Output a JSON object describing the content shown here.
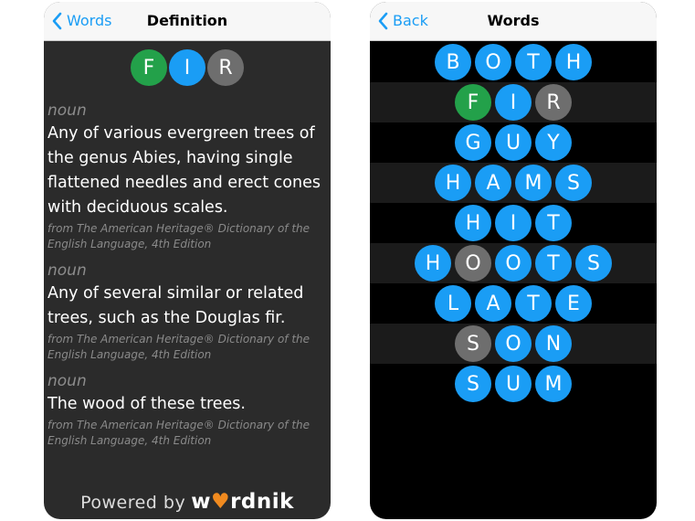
{
  "definition_screen": {
    "nav": {
      "back_label": "Words",
      "title": "Definition"
    },
    "word_tiles": [
      {
        "letter": "F",
        "color": "#23a14a"
      },
      {
        "letter": "I",
        "color": "#1a9df5"
      },
      {
        "letter": "R",
        "color": "#6e6e6e"
      }
    ],
    "definitions": [
      {
        "pos": "noun",
        "text": "Any of various evergreen trees of the genus Abies, having single flattened needles and erect cones with deciduous scales.",
        "source": "from The American Heritage® Dictionary of the English Language, 4th Edition"
      },
      {
        "pos": "noun",
        "text": "Any of several similar or related trees, such as the Douglas fir.",
        "source": "from The American Heritage® Dictionary of the English Language, 4th Edition"
      },
      {
        "pos": "noun",
        "text": "The wood of these trees.",
        "source": "from The American Heritage® Dictionary of the English Language, 4th Edition"
      }
    ],
    "powered_by": {
      "prefix": "Powered by",
      "brand_start": "w",
      "brand_heart": "♥",
      "brand_end": "rdnik"
    }
  },
  "words_screen": {
    "nav": {
      "back_label": "Back",
      "title": "Words"
    },
    "words": [
      {
        "word": "BOTH",
        "tiles": [
          {
            "letter": "B",
            "color": "blue"
          },
          {
            "letter": "O",
            "color": "blue"
          },
          {
            "letter": "T",
            "color": "blue"
          },
          {
            "letter": "H",
            "color": "blue"
          }
        ]
      },
      {
        "word": "FIR",
        "tiles": [
          {
            "letter": "F",
            "color": "green"
          },
          {
            "letter": "I",
            "color": "blue"
          },
          {
            "letter": "R",
            "color": "gray"
          }
        ]
      },
      {
        "word": "GUY",
        "tiles": [
          {
            "letter": "G",
            "color": "blue"
          },
          {
            "letter": "U",
            "color": "blue"
          },
          {
            "letter": "Y",
            "color": "blue"
          }
        ]
      },
      {
        "word": "HAMS",
        "tiles": [
          {
            "letter": "H",
            "color": "blue"
          },
          {
            "letter": "A",
            "color": "blue"
          },
          {
            "letter": "M",
            "color": "blue"
          },
          {
            "letter": "S",
            "color": "blue"
          }
        ]
      },
      {
        "word": "HIT",
        "tiles": [
          {
            "letter": "H",
            "color": "blue"
          },
          {
            "letter": "I",
            "color": "blue"
          },
          {
            "letter": "T",
            "color": "blue"
          }
        ]
      },
      {
        "word": "HOOTS",
        "tiles": [
          {
            "letter": "H",
            "color": "blue"
          },
          {
            "letter": "O",
            "color": "gray"
          },
          {
            "letter": "O",
            "color": "blue"
          },
          {
            "letter": "T",
            "color": "blue"
          },
          {
            "letter": "S",
            "color": "blue"
          }
        ]
      },
      {
        "word": "LATE",
        "tiles": [
          {
            "letter": "L",
            "color": "blue"
          },
          {
            "letter": "A",
            "color": "blue"
          },
          {
            "letter": "T",
            "color": "blue"
          },
          {
            "letter": "E",
            "color": "blue"
          }
        ]
      },
      {
        "word": "SON",
        "tiles": [
          {
            "letter": "S",
            "color": "gray"
          },
          {
            "letter": "O",
            "color": "blue"
          },
          {
            "letter": "N",
            "color": "blue"
          }
        ]
      },
      {
        "word": "SUM",
        "tiles": [
          {
            "letter": "S",
            "color": "blue"
          },
          {
            "letter": "U",
            "color": "blue"
          },
          {
            "letter": "M",
            "color": "blue"
          }
        ]
      }
    ]
  },
  "colors": {
    "accent_blue": "#1a9df5",
    "green": "#23a14a",
    "gray": "#6e6e6e",
    "brand_heart": "#f08a1f"
  }
}
